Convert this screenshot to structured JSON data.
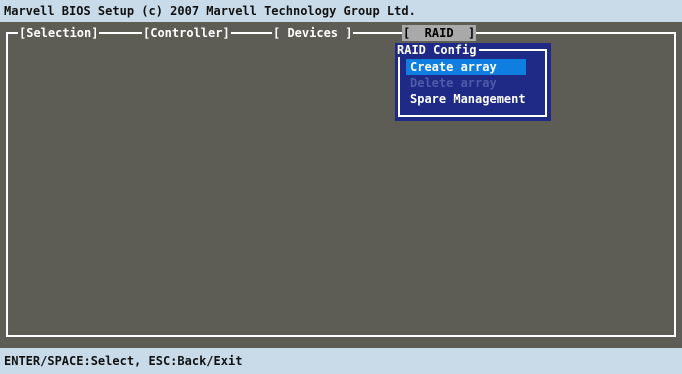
{
  "header": {
    "title": "Marvell BIOS Setup (c) 2007 Marvell Technology Group Ltd."
  },
  "tabs": [
    {
      "label": "[Selection]"
    },
    {
      "label": "[Controller]"
    },
    {
      "label": "[ Devices ]"
    },
    {
      "label": "[  RAID  ]"
    }
  ],
  "raid_menu": {
    "title": "RAID Config",
    "items": [
      {
        "label": "Create array",
        "state": "selected"
      },
      {
        "label": "Delete array",
        "state": "disabled"
      },
      {
        "label": "Spare Management",
        "state": "enabled"
      }
    ]
  },
  "footer": {
    "hint": "ENTER/SPACE:Select, ESC:Back/Exit"
  },
  "colors": {
    "background": "#5d5d56",
    "bar": "#c9dbe9",
    "menu_bg": "#1e2a86",
    "highlight": "#0e7fe0",
    "disabled_text": "#4f5ba8"
  }
}
